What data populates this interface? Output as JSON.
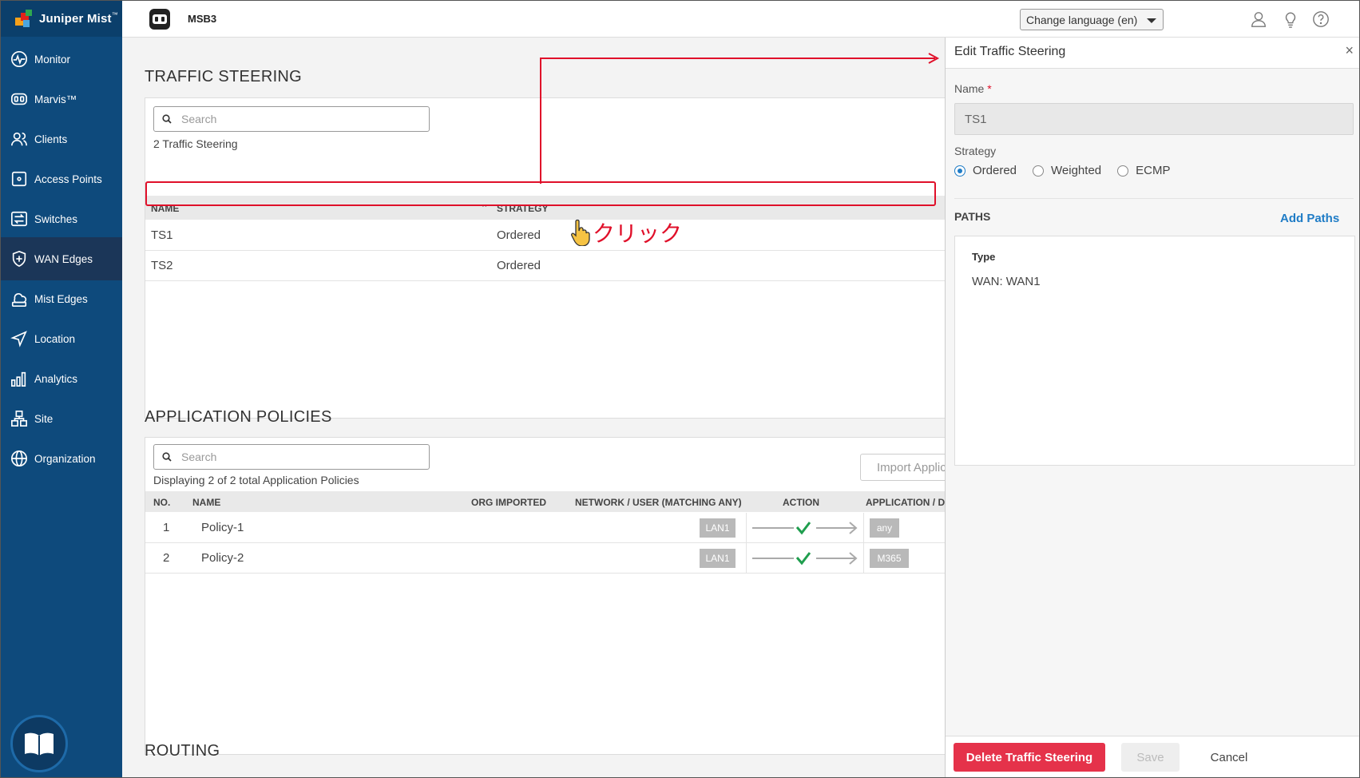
{
  "brand": {
    "name": "Juniper Mist",
    "tm": "™"
  },
  "sidebar": {
    "items": [
      {
        "label": "Monitor",
        "icon": "monitor-icon"
      },
      {
        "label": "Marvis™",
        "icon": "marvis-icon"
      },
      {
        "label": "Clients",
        "icon": "clients-icon"
      },
      {
        "label": "Access Points",
        "icon": "access-points-icon"
      },
      {
        "label": "Switches",
        "icon": "switches-icon"
      },
      {
        "label": "WAN Edges",
        "icon": "wan-edges-icon",
        "active": true
      },
      {
        "label": "Mist Edges",
        "icon": "mist-edges-icon"
      },
      {
        "label": "Location",
        "icon": "location-icon"
      },
      {
        "label": "Analytics",
        "icon": "analytics-icon"
      },
      {
        "label": "Site",
        "icon": "site-icon"
      },
      {
        "label": "Organization",
        "icon": "organization-icon"
      }
    ]
  },
  "topbar": {
    "site": "MSB3",
    "language": "Change language (en)"
  },
  "traffic_steering": {
    "title": "TRAFFIC STEERING",
    "search_placeholder": "Search",
    "count": "2 Traffic Steering",
    "columns": {
      "name": "NAME",
      "strategy": "STRATEGY"
    },
    "rows": [
      {
        "name": "TS1",
        "strategy": "Ordered"
      },
      {
        "name": "TS2",
        "strategy": "Ordered"
      }
    ]
  },
  "app_policies": {
    "title": "APPLICATION POLICIES",
    "search_placeholder": "Search",
    "count": "Displaying 2 of 2 total Application Policies",
    "import_label": "Import Applica",
    "columns": {
      "no": "NO.",
      "name": "NAME",
      "org": "ORG IMPORTED",
      "network": "NETWORK / USER (MATCHING ANY)",
      "action": "ACTION",
      "app": "APPLICATION / D"
    },
    "rows": [
      {
        "no": "1",
        "name": "Policy-1",
        "network": "LAN1",
        "app": "any"
      },
      {
        "no": "2",
        "name": "Policy-2",
        "network": "LAN1",
        "app": "M365"
      }
    ]
  },
  "routing": {
    "title": "ROUTING"
  },
  "annotation": {
    "click_text": "クリック"
  },
  "panel": {
    "title": "Edit Traffic Steering",
    "close": "×",
    "name_label": "Name",
    "required_mark": "*",
    "name_value": "TS1",
    "strategy_label": "Strategy",
    "strategies": [
      "Ordered",
      "Weighted",
      "ECMP"
    ],
    "selected_strategy": "Ordered",
    "paths_label": "PATHS",
    "add_paths": "Add Paths",
    "paths_type_header": "Type",
    "paths_value": "WAN: WAN1",
    "delete_label": "Delete Traffic Steering",
    "save_label": "Save",
    "cancel_label": "Cancel"
  },
  "colors": {
    "sidebar": "#0e4a7c",
    "accent": "#1f7cc6",
    "danger": "#e5324a",
    "annotation": "#e0102a"
  }
}
